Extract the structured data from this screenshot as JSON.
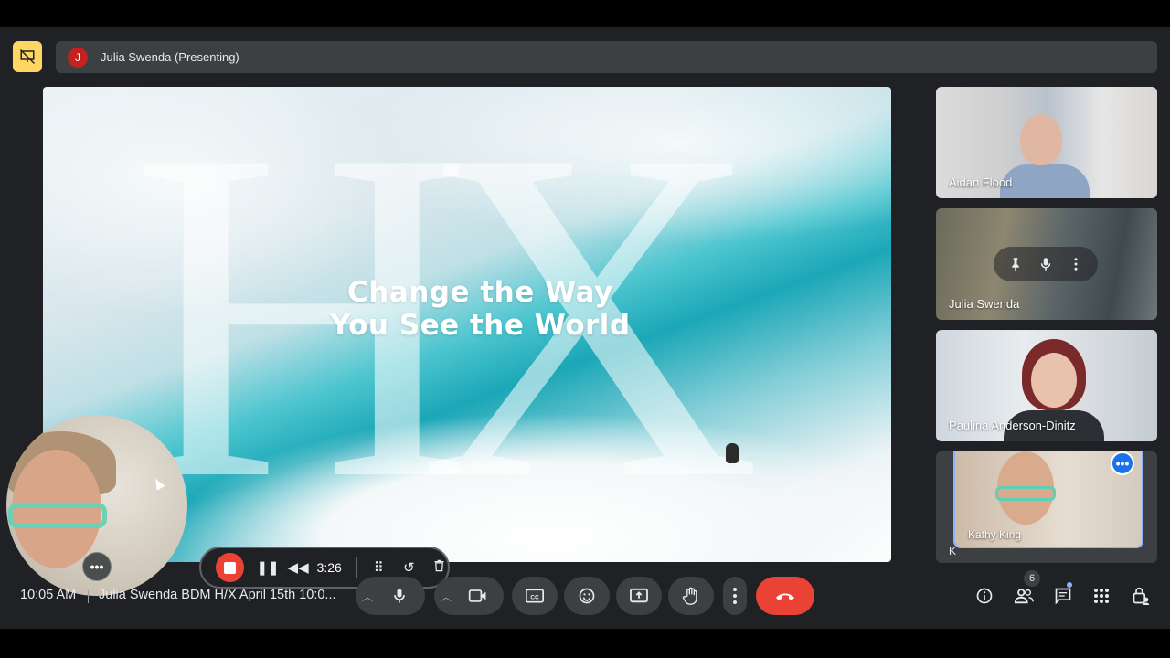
{
  "presenter": {
    "avatar_initial": "J",
    "label": "Julia Swenda (Presenting)"
  },
  "slide": {
    "letters": "HX",
    "title_line1": "Change the Way",
    "title_line2": "You See the World"
  },
  "participants": [
    {
      "name": "Aidan Flood"
    },
    {
      "name": "Julia Swenda"
    },
    {
      "name": "Paulina Anderson-Dinitz"
    },
    {
      "name": "Kathy King",
      "overflow_label": "K"
    }
  ],
  "tile_controls": {
    "pin_icon": "pin-icon",
    "mic_icon": "mic-icon",
    "more_icon": "more-vert-icon"
  },
  "recording": {
    "elapsed": "3:26"
  },
  "footer": {
    "time": "10:05 AM",
    "separator": "|",
    "meeting_title": "Julia Swenda BDM H/X April 15th 10:0..."
  },
  "people_count": "6",
  "colors": {
    "accent": "#8ab4f8",
    "hangup": "#ea4335",
    "present_icon_bg": "#fdd663",
    "avatar_bg": "#c5221f",
    "record": "#ea4335"
  }
}
